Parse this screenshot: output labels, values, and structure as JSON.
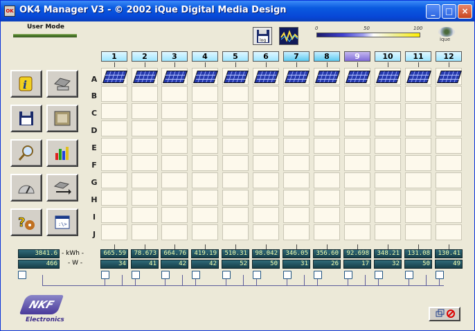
{
  "window": {
    "title": "OK4 Manager V3 - © 2002 iQue Digital Media Design",
    "minimize_glyph": "_",
    "maximize_glyph": "□",
    "close_glyph": "×"
  },
  "user_mode": "User Mode",
  "scale": {
    "min": "0",
    "mid": "50",
    "max": "100"
  },
  "ique_label": "ique",
  "log_label": "log",
  "columns": [
    "1",
    "2",
    "3",
    "4",
    "5",
    "6",
    "7",
    "8",
    "9",
    "10",
    "11",
    "12"
  ],
  "selected_column": "9",
  "rows": [
    "A",
    "B",
    "C",
    "D",
    "E",
    "F",
    "G",
    "H",
    "I",
    "J"
  ],
  "totals": {
    "kwh": "3841.6",
    "w": "466",
    "kwh_label": "- kWh -",
    "w_label": "- W -"
  },
  "kwh_values": [
    "665.59",
    "78.673",
    "664.76",
    "419.19",
    "510.31",
    "98.042",
    "346.05",
    "356.60",
    "92.698",
    "348.21",
    "131.08",
    "130.41"
  ],
  "w_values": [
    "34",
    "41",
    "42",
    "42",
    "52",
    "50",
    "31",
    "26",
    "17",
    "32",
    "50",
    "49"
  ],
  "logo": {
    "brand": "NKF",
    "sub": "Electronics"
  },
  "colors": {
    "title_blue": "#0a5ae0",
    "lcd_text": "#f2ffb0",
    "lcd_bg": "#1f4c58",
    "panel_blue": "#1a2fa8",
    "cell_bg": "#fdf9ec"
  }
}
